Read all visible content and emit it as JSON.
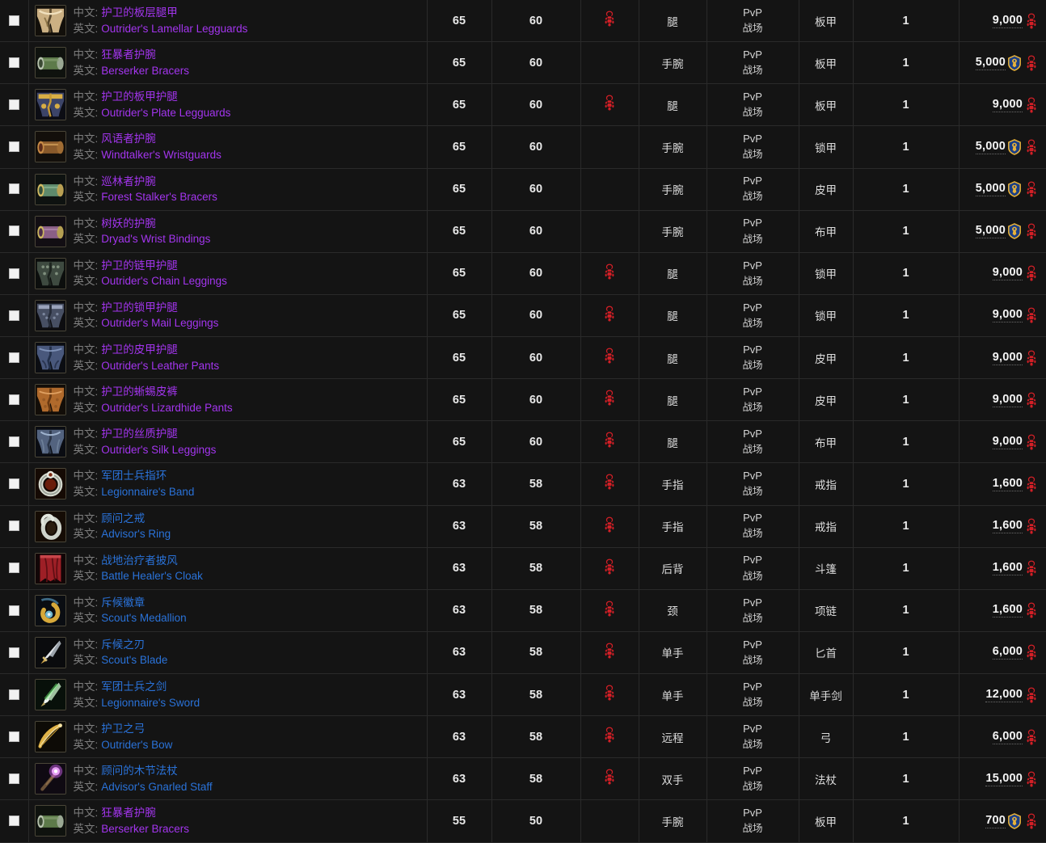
{
  "labels": {
    "cn_prefix": "中文:",
    "en_prefix": "英文:",
    "source_line1": "PvP",
    "source_line2": "战场"
  },
  "colors": {
    "epic": "#a335ee",
    "rare": "#2a72d8",
    "horde": "#c8202a",
    "alliance_gold": "#e0a020",
    "row_bg": "#141414",
    "grid": "#2a2a2a",
    "text": "#e8e8e8"
  },
  "icons": {
    "horde_emblem": "horde-emblem-icon",
    "alliance_emblem": "alliance-emblem-icon",
    "checkbox": "checkbox-icon"
  },
  "rows": [
    {
      "cn": "护卫的板层腿甲",
      "en": "Outrider's Lamellar Legguards",
      "quality": "epic",
      "ilvl": "65",
      "req": "60",
      "faction": "horde",
      "slot": "腿",
      "type": "板甲",
      "qty": "1",
      "cost": "9,000",
      "currencies": [
        "horde"
      ],
      "icon": "legs-plate-gold"
    },
    {
      "cn": "狂暴者护腕",
      "en": "Berserker Bracers",
      "quality": "epic",
      "ilvl": "65",
      "req": "60",
      "faction": "none",
      "slot": "手腕",
      "type": "板甲",
      "qty": "1",
      "cost": "5,000",
      "currencies": [
        "alliance",
        "horde"
      ],
      "icon": "bracer-green"
    },
    {
      "cn": "护卫的板甲护腿",
      "en": "Outrider's Plate Legguards",
      "quality": "epic",
      "ilvl": "65",
      "req": "60",
      "faction": "horde",
      "slot": "腿",
      "type": "板甲",
      "qty": "1",
      "cost": "9,000",
      "currencies": [
        "horde"
      ],
      "icon": "legs-plate-blue"
    },
    {
      "cn": "风语者护腕",
      "en": "Windtalker's Wristguards",
      "quality": "epic",
      "ilvl": "65",
      "req": "60",
      "faction": "none",
      "slot": "手腕",
      "type": "锁甲",
      "qty": "1",
      "cost": "5,000",
      "currencies": [
        "alliance",
        "horde"
      ],
      "icon": "bracer-copper"
    },
    {
      "cn": "巡林者护腕",
      "en": "Forest Stalker's Bracers",
      "quality": "epic",
      "ilvl": "65",
      "req": "60",
      "faction": "none",
      "slot": "手腕",
      "type": "皮甲",
      "qty": "1",
      "cost": "5,000",
      "currencies": [
        "alliance",
        "horde"
      ],
      "icon": "bracer-teal"
    },
    {
      "cn": "树妖的护腕",
      "en": "Dryad's Wrist Bindings",
      "quality": "epic",
      "ilvl": "65",
      "req": "60",
      "faction": "none",
      "slot": "手腕",
      "type": "布甲",
      "qty": "1",
      "cost": "5,000",
      "currencies": [
        "alliance",
        "horde"
      ],
      "icon": "bracer-purple"
    },
    {
      "cn": "护卫的链甲护腿",
      "en": "Outrider's Chain Leggings",
      "quality": "epic",
      "ilvl": "65",
      "req": "60",
      "faction": "horde",
      "slot": "腿",
      "type": "锁甲",
      "qty": "1",
      "cost": "9,000",
      "currencies": [
        "horde"
      ],
      "icon": "legs-chain-dark"
    },
    {
      "cn": "护卫的锁甲护腿",
      "en": "Outrider's Mail Leggings",
      "quality": "epic",
      "ilvl": "65",
      "req": "60",
      "faction": "horde",
      "slot": "腿",
      "type": "锁甲",
      "qty": "1",
      "cost": "9,000",
      "currencies": [
        "horde"
      ],
      "icon": "legs-mail"
    },
    {
      "cn": "护卫的皮甲护腿",
      "en": "Outrider's Leather Pants",
      "quality": "epic",
      "ilvl": "65",
      "req": "60",
      "faction": "horde",
      "slot": "腿",
      "type": "皮甲",
      "qty": "1",
      "cost": "9,000",
      "currencies": [
        "horde"
      ],
      "icon": "legs-leather-blue"
    },
    {
      "cn": "护卫的蜥蜴皮裤",
      "en": "Outrider's Lizardhide Pants",
      "quality": "epic",
      "ilvl": "65",
      "req": "60",
      "faction": "horde",
      "slot": "腿",
      "type": "皮甲",
      "qty": "1",
      "cost": "9,000",
      "currencies": [
        "horde"
      ],
      "icon": "legs-lizard-orange"
    },
    {
      "cn": "护卫的丝质护腿",
      "en": "Outrider's Silk Leggings",
      "quality": "epic",
      "ilvl": "65",
      "req": "60",
      "faction": "horde",
      "slot": "腿",
      "type": "布甲",
      "qty": "1",
      "cost": "9,000",
      "currencies": [
        "horde"
      ],
      "icon": "legs-silk-blue"
    },
    {
      "cn": "军团士兵指环",
      "en": "Legionnaire's Band",
      "quality": "rare",
      "ilvl": "63",
      "req": "58",
      "faction": "horde",
      "slot": "手指",
      "type": "戒指",
      "qty": "1",
      "cost": "1,600",
      "currencies": [
        "horde"
      ],
      "icon": "ring-orange"
    },
    {
      "cn": "顾问之戒",
      "en": "Advisor's Ring",
      "quality": "rare",
      "ilvl": "63",
      "req": "58",
      "faction": "horde",
      "slot": "手指",
      "type": "戒指",
      "qty": "1",
      "cost": "1,600",
      "currencies": [
        "horde"
      ],
      "icon": "ring-silver"
    },
    {
      "cn": "战地治疗者披风",
      "en": "Battle Healer's Cloak",
      "quality": "rare",
      "ilvl": "63",
      "req": "58",
      "faction": "horde",
      "slot": "后背",
      "type": "斗篷",
      "qty": "1",
      "cost": "1,600",
      "currencies": [
        "horde"
      ],
      "icon": "cloak-red"
    },
    {
      "cn": "斥候徽章",
      "en": "Scout's Medallion",
      "quality": "rare",
      "ilvl": "63",
      "req": "58",
      "faction": "horde",
      "slot": "颈",
      "type": "项链",
      "qty": "1",
      "cost": "1,600",
      "currencies": [
        "horde"
      ],
      "icon": "medallion-gold"
    },
    {
      "cn": "斥候之刃",
      "en": "Scout's Blade",
      "quality": "rare",
      "ilvl": "63",
      "req": "58",
      "faction": "horde",
      "slot": "单手",
      "type": "匕首",
      "qty": "1",
      "cost": "6,000",
      "currencies": [
        "horde"
      ],
      "icon": "dagger-steel"
    },
    {
      "cn": "军团士兵之剑",
      "en": "Legionnaire's Sword",
      "quality": "rare",
      "ilvl": "63",
      "req": "58",
      "faction": "horde",
      "slot": "单手",
      "type": "单手剑",
      "qty": "1",
      "cost": "12,000",
      "currencies": [
        "horde"
      ],
      "icon": "sword-green"
    },
    {
      "cn": "护卫之弓",
      "en": "Outrider's Bow",
      "quality": "rare",
      "ilvl": "63",
      "req": "58",
      "faction": "horde",
      "slot": "远程",
      "type": "弓",
      "qty": "1",
      "cost": "6,000",
      "currencies": [
        "horde"
      ],
      "icon": "bow-gold"
    },
    {
      "cn": "顾问的木节法杖",
      "en": "Advisor's Gnarled Staff",
      "quality": "rare",
      "ilvl": "63",
      "req": "58",
      "faction": "horde",
      "slot": "双手",
      "type": "法杖",
      "qty": "1",
      "cost": "15,000",
      "currencies": [
        "horde"
      ],
      "icon": "staff-purple"
    },
    {
      "cn": "狂暴者护腕",
      "en": "Berserker Bracers",
      "quality": "epic",
      "ilvl": "55",
      "req": "50",
      "faction": "none",
      "slot": "手腕",
      "type": "板甲",
      "qty": "1",
      "cost": "700",
      "currencies": [
        "alliance",
        "horde"
      ],
      "icon": "bracer-green"
    }
  ]
}
